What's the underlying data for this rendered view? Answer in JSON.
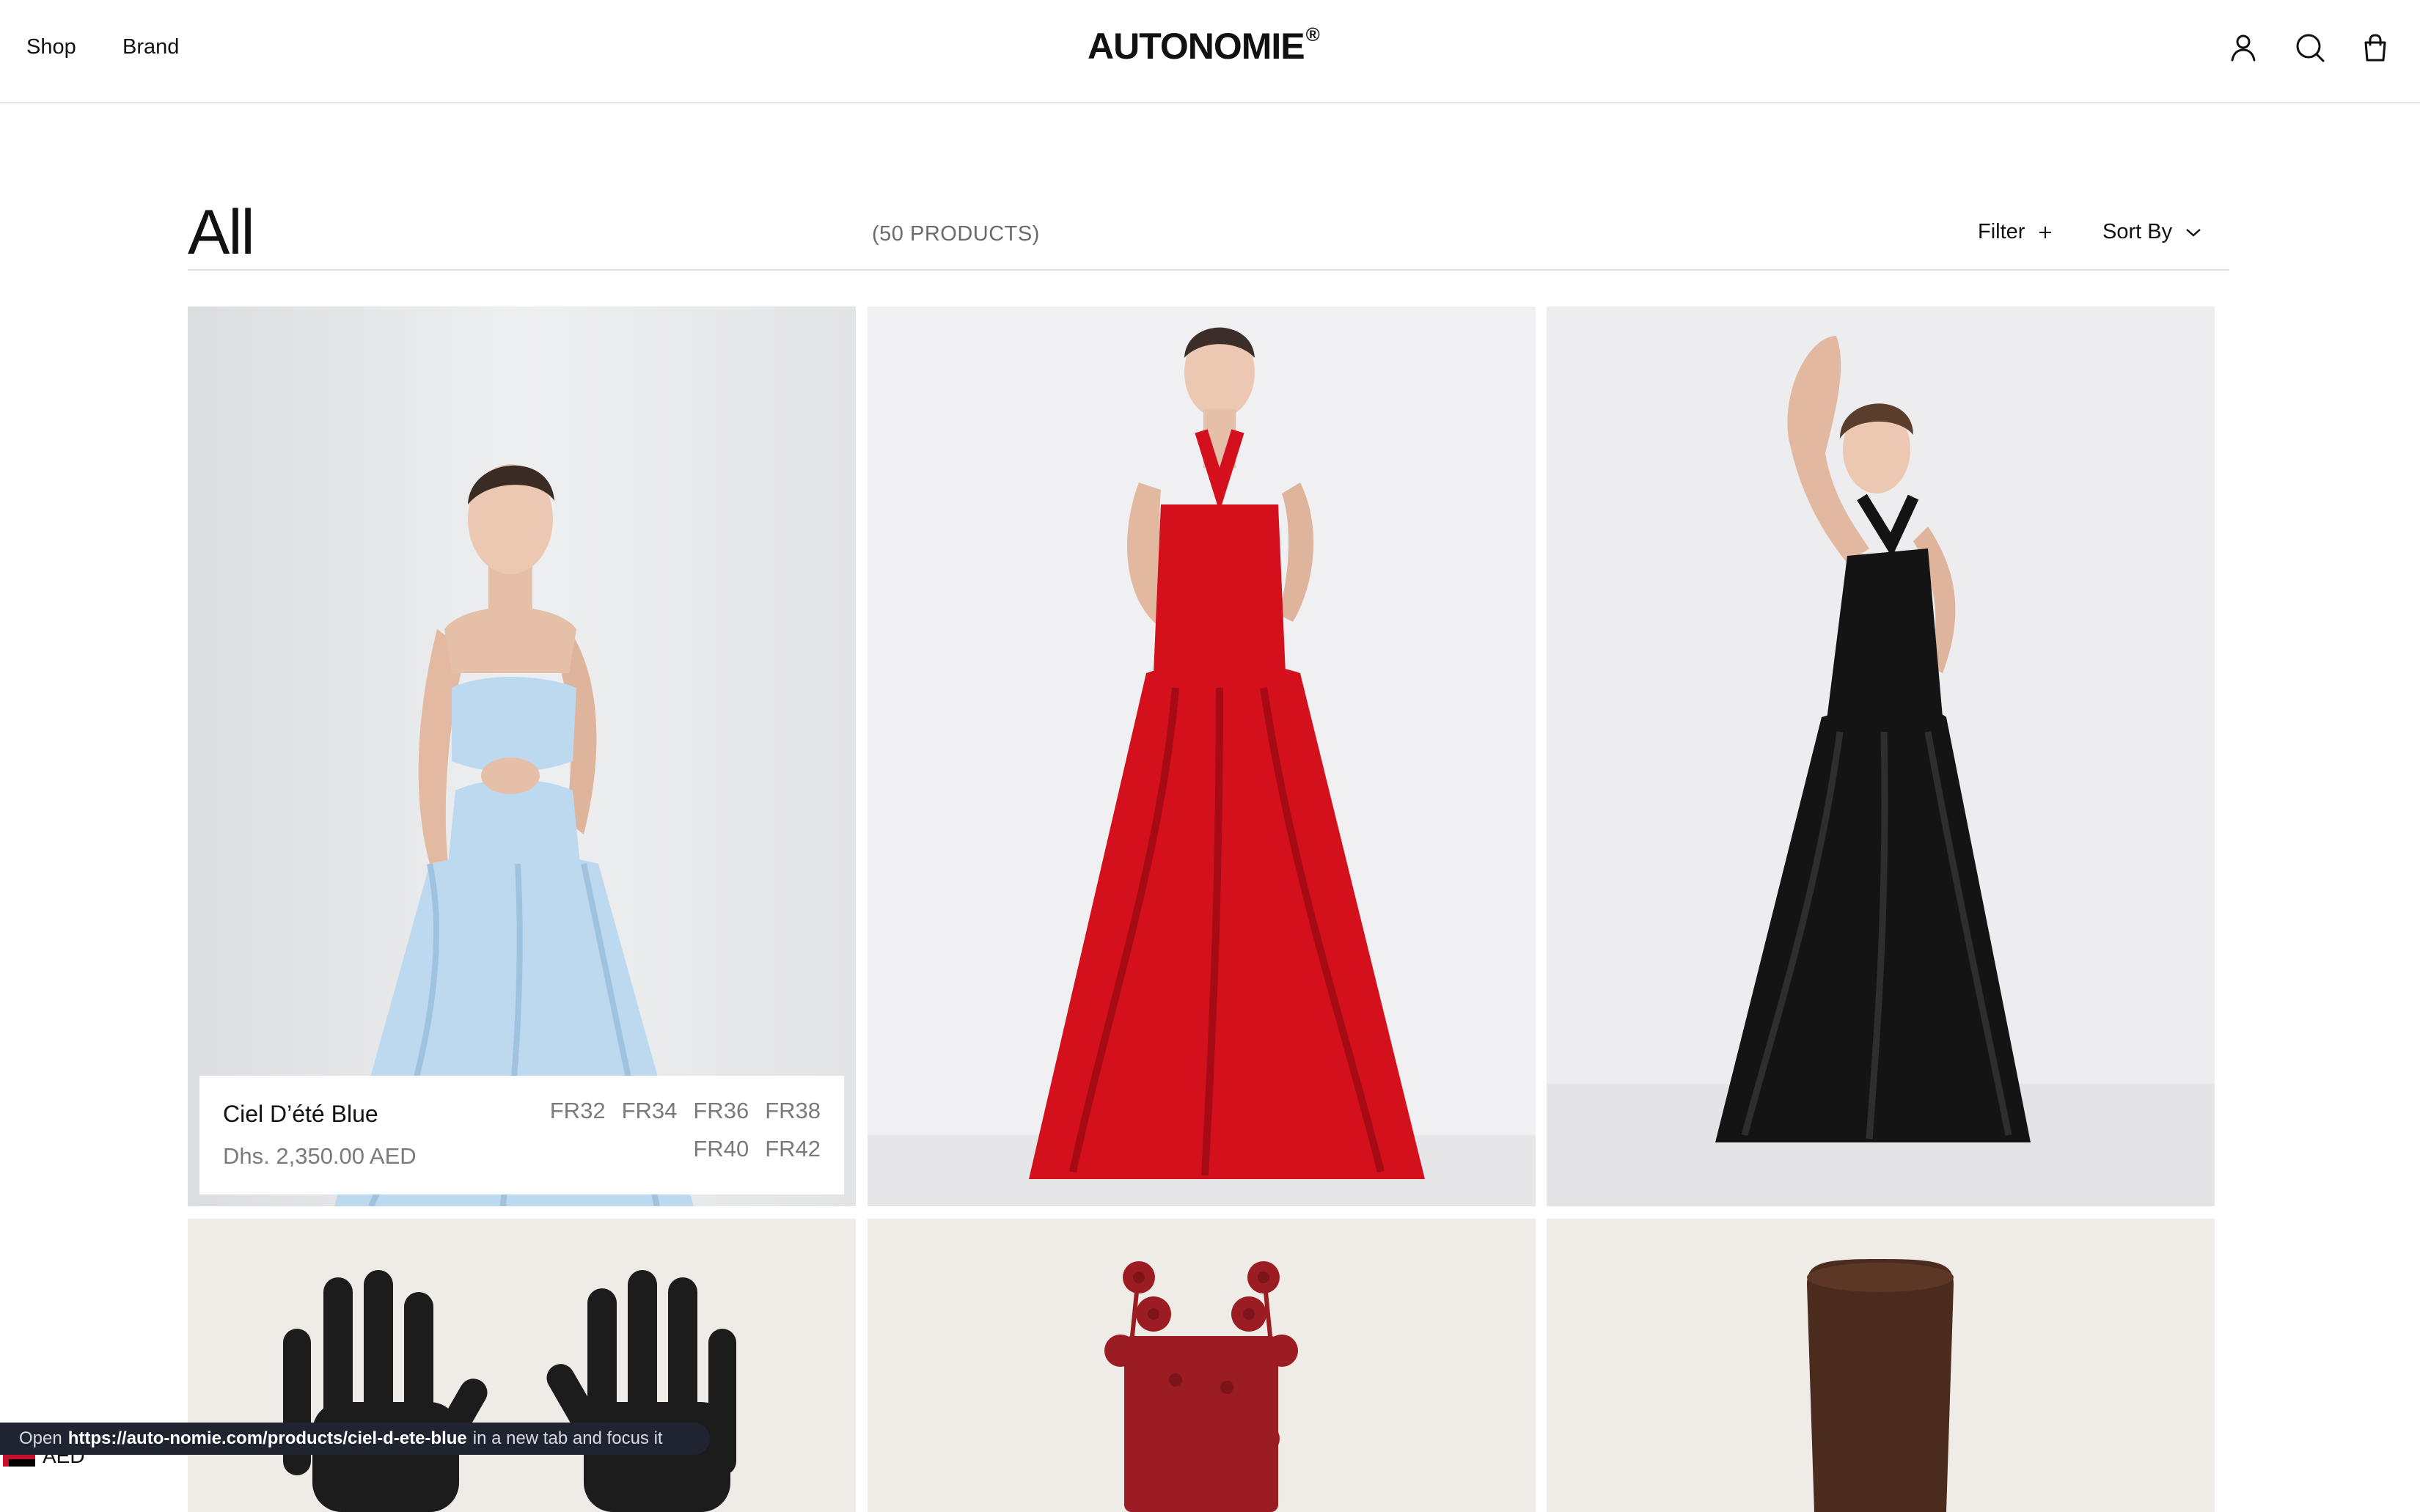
{
  "header": {
    "nav": {
      "shop": "Shop",
      "brand": "Brand"
    },
    "logo": "AUTONOMIE",
    "logo_mark": "®",
    "icons": [
      "account-icon",
      "search-icon",
      "bag-icon"
    ]
  },
  "collection": {
    "title": "All",
    "count": "(50 PRODUCTS)",
    "filter_label": "Filter",
    "sort_label": "Sort By"
  },
  "products": [
    {
      "name": "Ciel D’été Blue",
      "price": "Dhs. 2,350.00 AED",
      "sizes": [
        "FR32",
        "FR34",
        "FR36",
        "FR38",
        "FR40",
        "FR42"
      ],
      "dress_color": "#bcd9ef"
    },
    {
      "dress_color": "#d3101c"
    },
    {
      "dress_color": "#141414"
    },
    {
      "item": "gloves",
      "color": "#1c1c1c"
    },
    {
      "item": "flower-dress",
      "color": "#9b1c22"
    },
    {
      "item": "boot",
      "color": "#4a2b1e"
    }
  ],
  "status": {
    "prefix": "Open",
    "url": "https://auto-nomie.com/products/ciel-d-ete-blue",
    "suffix": "in a new tab and focus it"
  },
  "currency": {
    "label": "AED"
  }
}
